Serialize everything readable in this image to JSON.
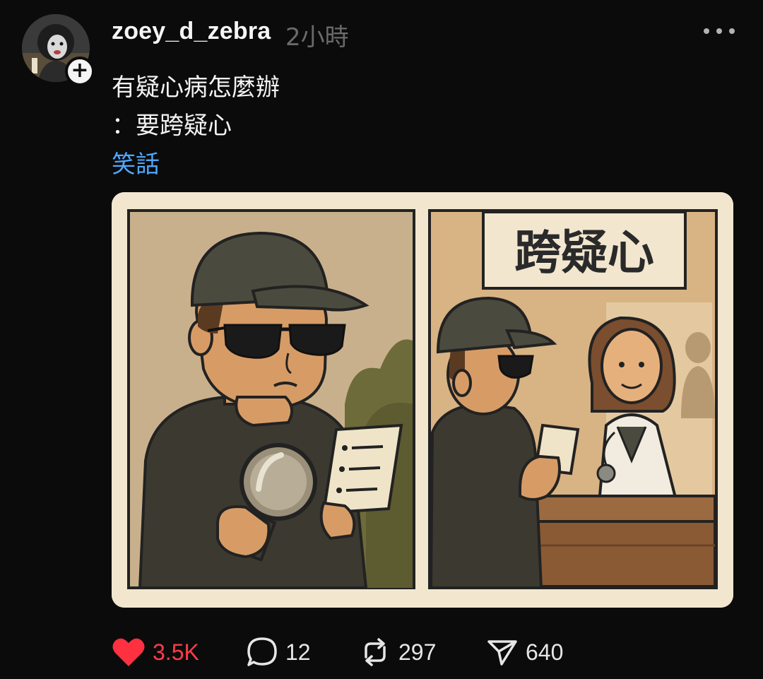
{
  "post": {
    "username": "zoey_d_zebra",
    "time": "2小時",
    "lines": [
      "有疑心病怎麼辦",
      "：要跨疑心"
    ],
    "tag": "笑話"
  },
  "image": {
    "sign_text": "跨疑心"
  },
  "actions": {
    "likes": "3.5K",
    "comments": "12",
    "reposts": "297",
    "shares": "640"
  },
  "colors": {
    "background": "#0b0b0b",
    "tag": "#4fa8ff",
    "liked": "#ff3b4a",
    "muted": "#6a6a6a"
  },
  "icons": [
    "avatar-icon",
    "plus-icon",
    "more-icon",
    "heart-icon",
    "comment-icon",
    "repost-icon",
    "share-icon"
  ]
}
